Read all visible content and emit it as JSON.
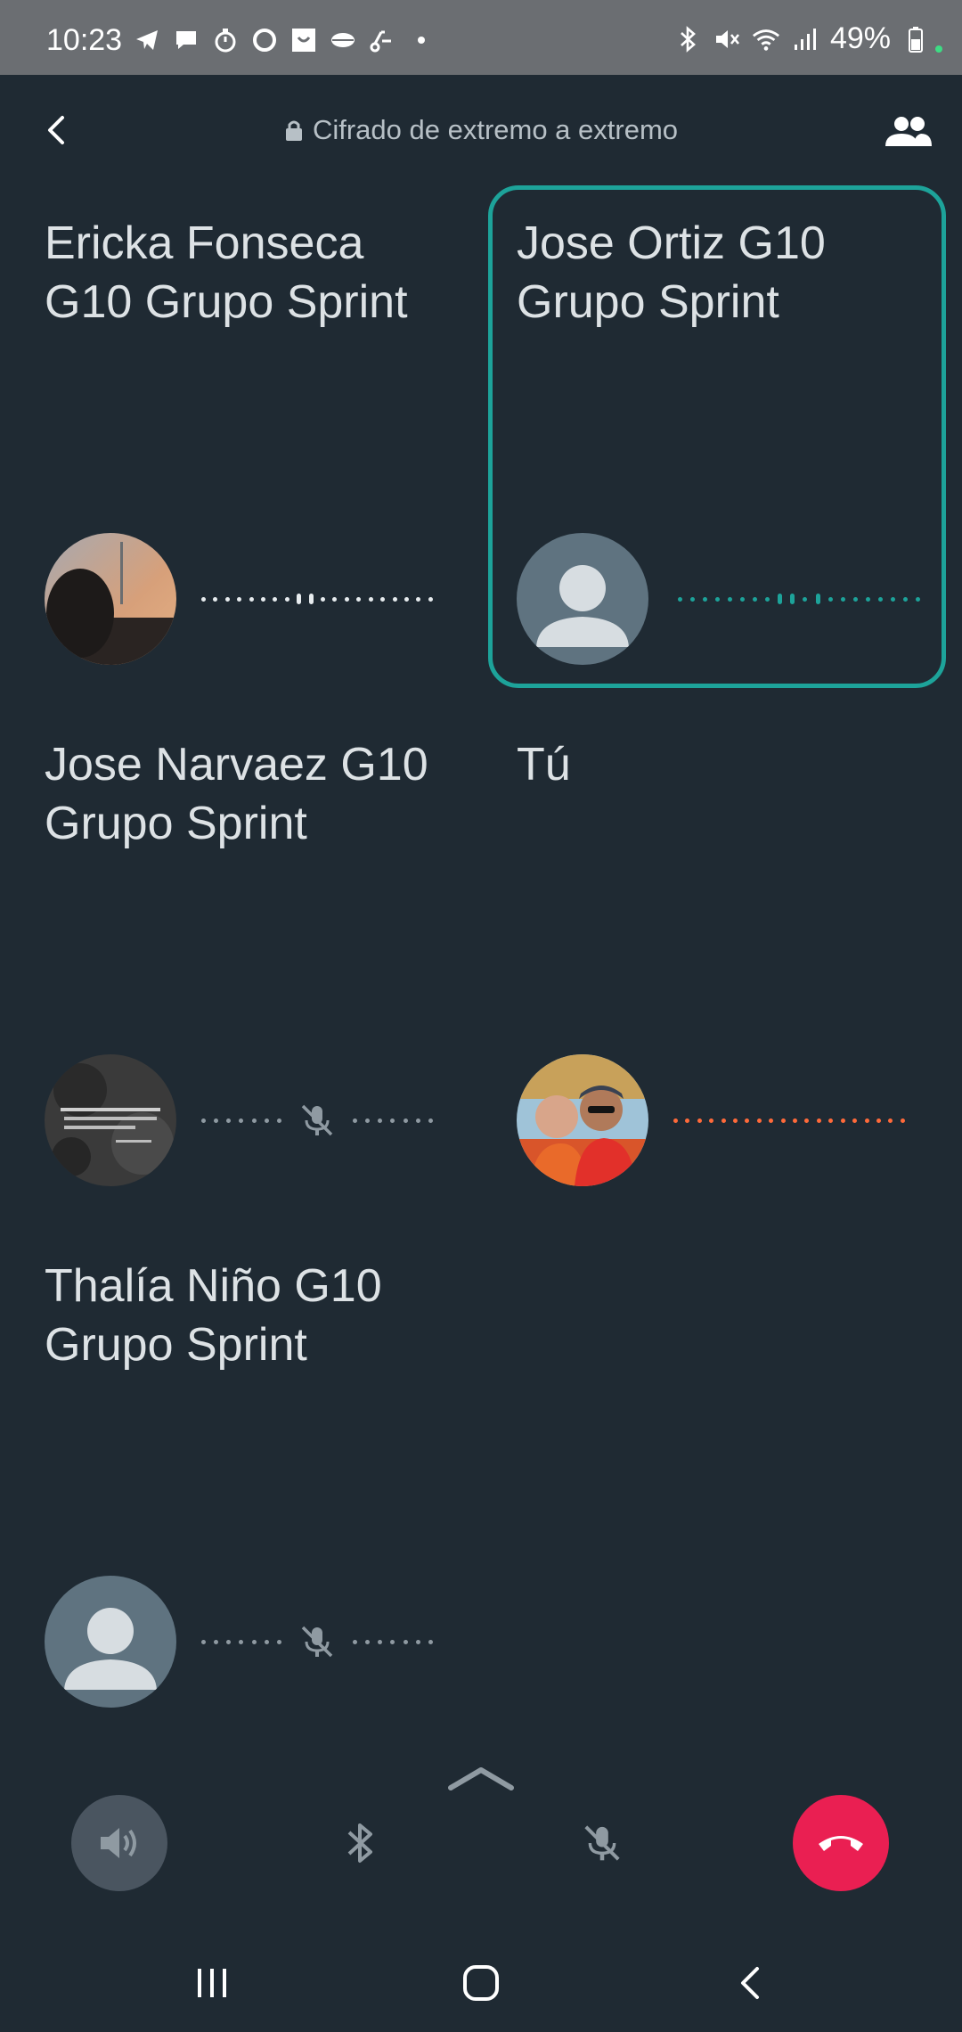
{
  "status_bar": {
    "time": "10:23",
    "battery": "49%",
    "notification_icons": [
      "telegram-icon",
      "message-icon",
      "timer-icon",
      "circle-app-icon",
      "bag-icon",
      "lips-icon",
      "scooter-icon",
      "dot-icon"
    ],
    "system_icons": [
      "bluetooth-icon",
      "vibrate-mute-icon",
      "wifi-icon",
      "signal-icon",
      "battery-icon"
    ]
  },
  "header": {
    "encryption_label": "Cifrado de extremo a extremo",
    "back_icon": "back-arrow-icon",
    "participants_icon": "participants-icon"
  },
  "participants": [
    {
      "name": "Ericka Fonseca G10 Grupo Sprint",
      "audio": "speaking-white",
      "muted": false,
      "active": false
    },
    {
      "name": "Jose Ortiz G10 Grupo Sprint",
      "audio": "speaking-teal",
      "muted": false,
      "active": true
    },
    {
      "name": "Jose Narvaez G10 Grupo Sprint",
      "audio": "muted",
      "muted": true,
      "active": false
    },
    {
      "name": "Tú",
      "audio": "speaking-orange",
      "muted": false,
      "active": false
    },
    {
      "name": "Thalía Niño G10 Grupo Sprint",
      "audio": "muted",
      "muted": true,
      "active": false
    }
  ],
  "controls": {
    "speaker_icon": "speaker-icon",
    "bluetooth_icon": "bluetooth-icon",
    "mute_icon": "mic-off-icon",
    "end_call_icon": "end-call-icon",
    "expand_icon": "chevron-up-icon"
  },
  "colors": {
    "background": "#1f2a33",
    "active_border": "#1da39a",
    "self_level": "#ff6a3a",
    "end_call": "#ea1f52"
  }
}
